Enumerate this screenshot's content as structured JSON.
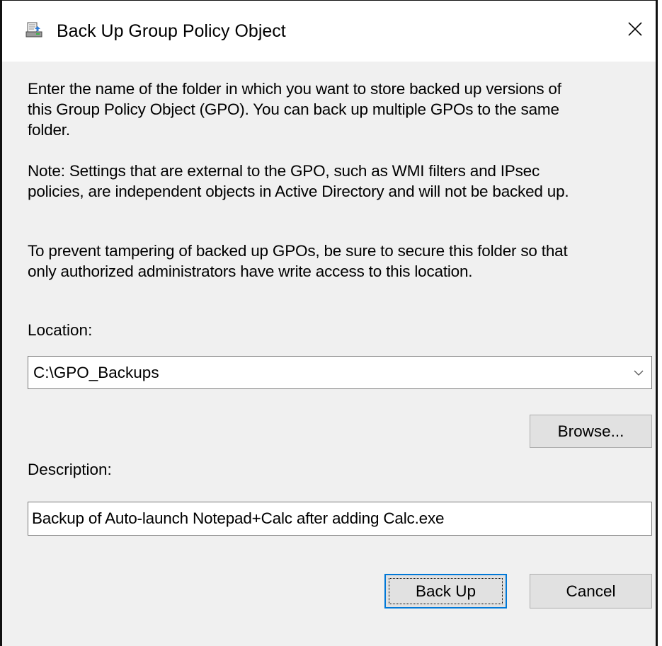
{
  "window": {
    "title": "Back Up Group Policy Object",
    "title_icon": "gpo-backup-icon",
    "close_icon": "close-icon"
  },
  "content": {
    "paragraph_1": "Enter the name of the folder in which you want to store backed up versions of\nthis Group Policy Object (GPO). You can back up multiple GPOs to the same\nfolder.",
    "paragraph_2": "Note: Settings that are external to the GPO, such as WMI filters and IPsec\npolicies, are independent objects in Active Directory and will not be backed up.",
    "paragraph_3": "To prevent tampering of backed up GPOs, be sure to secure this folder so that\nonly authorized administrators have write access to this location."
  },
  "location": {
    "label": "Location:",
    "value": "C:\\GPO_Backups",
    "dropdown_icon": "chevron-down-icon"
  },
  "browse_button": {
    "label": "Browse..."
  },
  "description": {
    "label": "Description:",
    "value": "Backup of Auto-launch Notepad+Calc after adding Calc.exe"
  },
  "buttons": {
    "backup": "Back Up",
    "cancel": "Cancel"
  },
  "colors": {
    "dialog_background": "#f0f0f0",
    "button_background": "#e1e1e1",
    "default_button_border": "#0078d7"
  }
}
